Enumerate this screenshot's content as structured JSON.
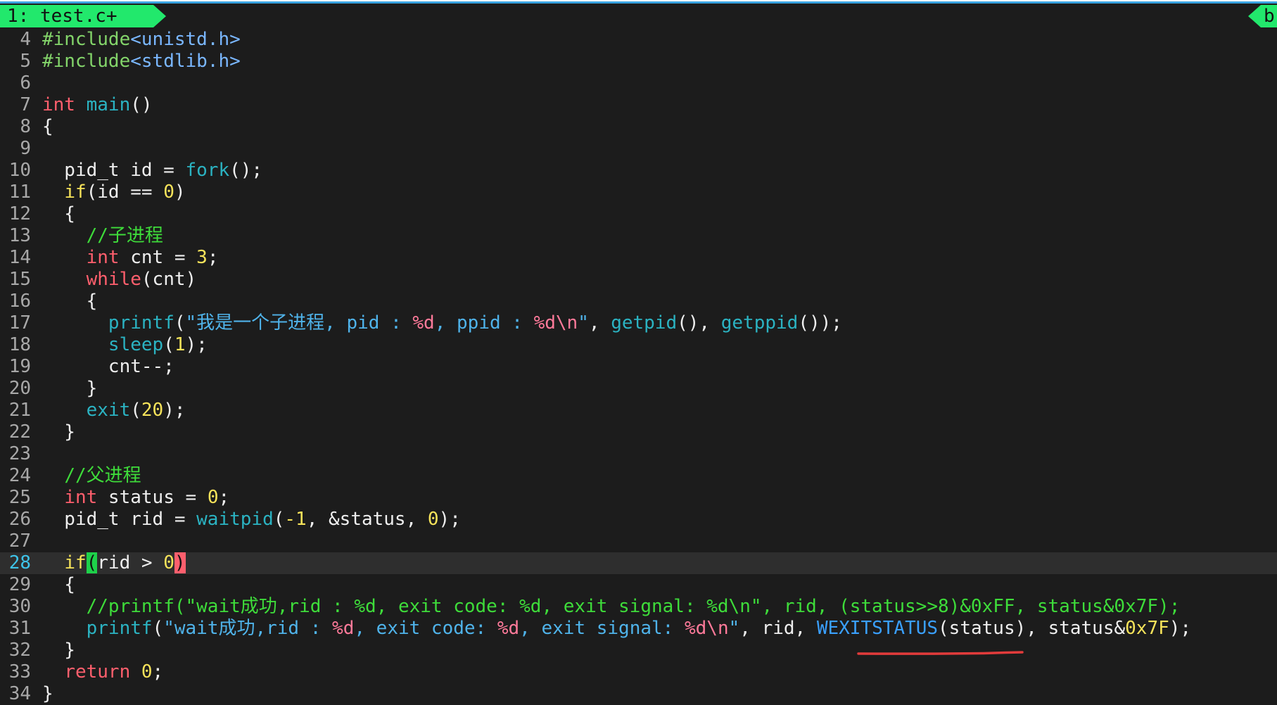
{
  "tabs": {
    "active": "1: test.c+",
    "right": "b"
  },
  "current_line": "28",
  "lines": [
    {
      "num": "4",
      "tokens": [
        {
          "c": "pp",
          "t": "#include"
        },
        {
          "c": "inc",
          "t": "<unistd.h>"
        }
      ]
    },
    {
      "num": "5",
      "tokens": [
        {
          "c": "pp",
          "t": "#include"
        },
        {
          "c": "inc",
          "t": "<stdlib.h>"
        }
      ]
    },
    {
      "num": "6",
      "tokens": []
    },
    {
      "num": "7",
      "tokens": [
        {
          "c": "kw",
          "t": "int"
        },
        {
          "c": "plain",
          "t": " "
        },
        {
          "c": "fn",
          "t": "main"
        },
        {
          "c": "plain",
          "t": "()"
        }
      ]
    },
    {
      "num": "8",
      "tokens": [
        {
          "c": "plain",
          "t": "{"
        }
      ]
    },
    {
      "num": "9",
      "tokens": []
    },
    {
      "num": "10",
      "tokens": [
        {
          "c": "plain",
          "t": "  pid_t id = "
        },
        {
          "c": "fn",
          "t": "fork"
        },
        {
          "c": "plain",
          "t": "();"
        }
      ]
    },
    {
      "num": "11",
      "tokens": [
        {
          "c": "plain",
          "t": "  "
        },
        {
          "c": "ctl",
          "t": "if"
        },
        {
          "c": "plain",
          "t": "(id == "
        },
        {
          "c": "num",
          "t": "0"
        },
        {
          "c": "plain",
          "t": ")"
        }
      ]
    },
    {
      "num": "12",
      "tokens": [
        {
          "c": "plain",
          "t": "  {"
        }
      ]
    },
    {
      "num": "13",
      "tokens": [
        {
          "c": "plain",
          "t": "    "
        },
        {
          "c": "cmt",
          "t": "//子进程"
        }
      ]
    },
    {
      "num": "14",
      "tokens": [
        {
          "c": "plain",
          "t": "    "
        },
        {
          "c": "kw",
          "t": "int"
        },
        {
          "c": "plain",
          "t": " cnt = "
        },
        {
          "c": "num",
          "t": "3"
        },
        {
          "c": "plain",
          "t": ";"
        }
      ]
    },
    {
      "num": "15",
      "tokens": [
        {
          "c": "plain",
          "t": "    "
        },
        {
          "c": "kw",
          "t": "while"
        },
        {
          "c": "plain",
          "t": "(cnt)"
        }
      ]
    },
    {
      "num": "16",
      "tokens": [
        {
          "c": "plain",
          "t": "    {"
        }
      ]
    },
    {
      "num": "17",
      "tokens": [
        {
          "c": "plain",
          "t": "      "
        },
        {
          "c": "fn",
          "t": "printf"
        },
        {
          "c": "plain",
          "t": "("
        },
        {
          "c": "str",
          "t": "\"我是一个子进程, pid : "
        },
        {
          "c": "fmt",
          "t": "%d"
        },
        {
          "c": "str",
          "t": ", ppid : "
        },
        {
          "c": "fmt",
          "t": "%d\\n"
        },
        {
          "c": "str",
          "t": "\""
        },
        {
          "c": "plain",
          "t": ", "
        },
        {
          "c": "fn",
          "t": "getpid"
        },
        {
          "c": "plain",
          "t": "(), "
        },
        {
          "c": "fn",
          "t": "getppid"
        },
        {
          "c": "plain",
          "t": "());"
        }
      ]
    },
    {
      "num": "18",
      "tokens": [
        {
          "c": "plain",
          "t": "      "
        },
        {
          "c": "fn",
          "t": "sleep"
        },
        {
          "c": "plain",
          "t": "("
        },
        {
          "c": "num",
          "t": "1"
        },
        {
          "c": "plain",
          "t": ");"
        }
      ]
    },
    {
      "num": "19",
      "tokens": [
        {
          "c": "plain",
          "t": "      cnt--;"
        }
      ]
    },
    {
      "num": "20",
      "tokens": [
        {
          "c": "plain",
          "t": "    }"
        }
      ]
    },
    {
      "num": "21",
      "tokens": [
        {
          "c": "plain",
          "t": "    "
        },
        {
          "c": "fn",
          "t": "exit"
        },
        {
          "c": "plain",
          "t": "("
        },
        {
          "c": "num",
          "t": "20"
        },
        {
          "c": "plain",
          "t": ");"
        }
      ]
    },
    {
      "num": "22",
      "tokens": [
        {
          "c": "plain",
          "t": "  }"
        }
      ]
    },
    {
      "num": "23",
      "tokens": []
    },
    {
      "num": "24",
      "tokens": [
        {
          "c": "plain",
          "t": "  "
        },
        {
          "c": "cmt",
          "t": "//父进程"
        }
      ]
    },
    {
      "num": "25",
      "tokens": [
        {
          "c": "plain",
          "t": "  "
        },
        {
          "c": "kw",
          "t": "int"
        },
        {
          "c": "plain",
          "t": " status = "
        },
        {
          "c": "num",
          "t": "0"
        },
        {
          "c": "plain",
          "t": ";"
        }
      ]
    },
    {
      "num": "26",
      "tokens": [
        {
          "c": "plain",
          "t": "  pid_t rid = "
        },
        {
          "c": "fn",
          "t": "waitpid"
        },
        {
          "c": "plain",
          "t": "("
        },
        {
          "c": "num",
          "t": "-1"
        },
        {
          "c": "plain",
          "t": ", &status, "
        },
        {
          "c": "num",
          "t": "0"
        },
        {
          "c": "plain",
          "t": ");"
        }
      ]
    },
    {
      "num": "27",
      "tokens": []
    },
    {
      "num": "28",
      "tokens": [
        {
          "c": "plain",
          "t": "  "
        },
        {
          "c": "ctl",
          "t": "if"
        },
        {
          "c": "bracket-open",
          "t": "("
        },
        {
          "c": "plain",
          "t": "rid > "
        },
        {
          "c": "num",
          "t": "0"
        },
        {
          "c": "bracket-close",
          "t": ")"
        }
      ]
    },
    {
      "num": "29",
      "tokens": [
        {
          "c": "plain",
          "t": "  {"
        }
      ]
    },
    {
      "num": "30",
      "tokens": [
        {
          "c": "plain",
          "t": "    "
        },
        {
          "c": "cmt",
          "t": "//printf(\"wait成功,rid : %d, exit code: %d, exit signal: %d\\n\", rid, (status>>8)&0xFF, status&0x7F);"
        }
      ]
    },
    {
      "num": "31",
      "tokens": [
        {
          "c": "plain",
          "t": "    "
        },
        {
          "c": "fn",
          "t": "printf"
        },
        {
          "c": "plain",
          "t": "("
        },
        {
          "c": "str",
          "t": "\"wait成功,rid : "
        },
        {
          "c": "fmt",
          "t": "%d"
        },
        {
          "c": "str",
          "t": ", exit code: "
        },
        {
          "c": "fmt",
          "t": "%d"
        },
        {
          "c": "str",
          "t": ", exit signal: "
        },
        {
          "c": "fmt",
          "t": "%d\\n"
        },
        {
          "c": "str",
          "t": "\""
        },
        {
          "c": "plain",
          "t": ", rid, "
        },
        {
          "c": "macro",
          "t": "WEXITSTATUS"
        },
        {
          "c": "plain",
          "t": "(status), status&"
        },
        {
          "c": "num",
          "t": "0x7F"
        },
        {
          "c": "plain",
          "t": ");"
        }
      ]
    },
    {
      "num": "32",
      "tokens": [
        {
          "c": "plain",
          "t": "  }"
        }
      ]
    },
    {
      "num": "33",
      "tokens": [
        {
          "c": "plain",
          "t": "  "
        },
        {
          "c": "kw",
          "t": "return"
        },
        {
          "c": "plain",
          "t": " "
        },
        {
          "c": "num",
          "t": "0"
        },
        {
          "c": "plain",
          "t": ";"
        }
      ]
    },
    {
      "num": "34",
      "tokens": [
        {
          "c": "plain",
          "t": "}"
        }
      ]
    }
  ],
  "colors": {
    "background": "#1c1c1c",
    "tab_active": "#22e86c",
    "current_line_bg": "#2e2e2e",
    "annotation_underline": "#e23b3b"
  }
}
